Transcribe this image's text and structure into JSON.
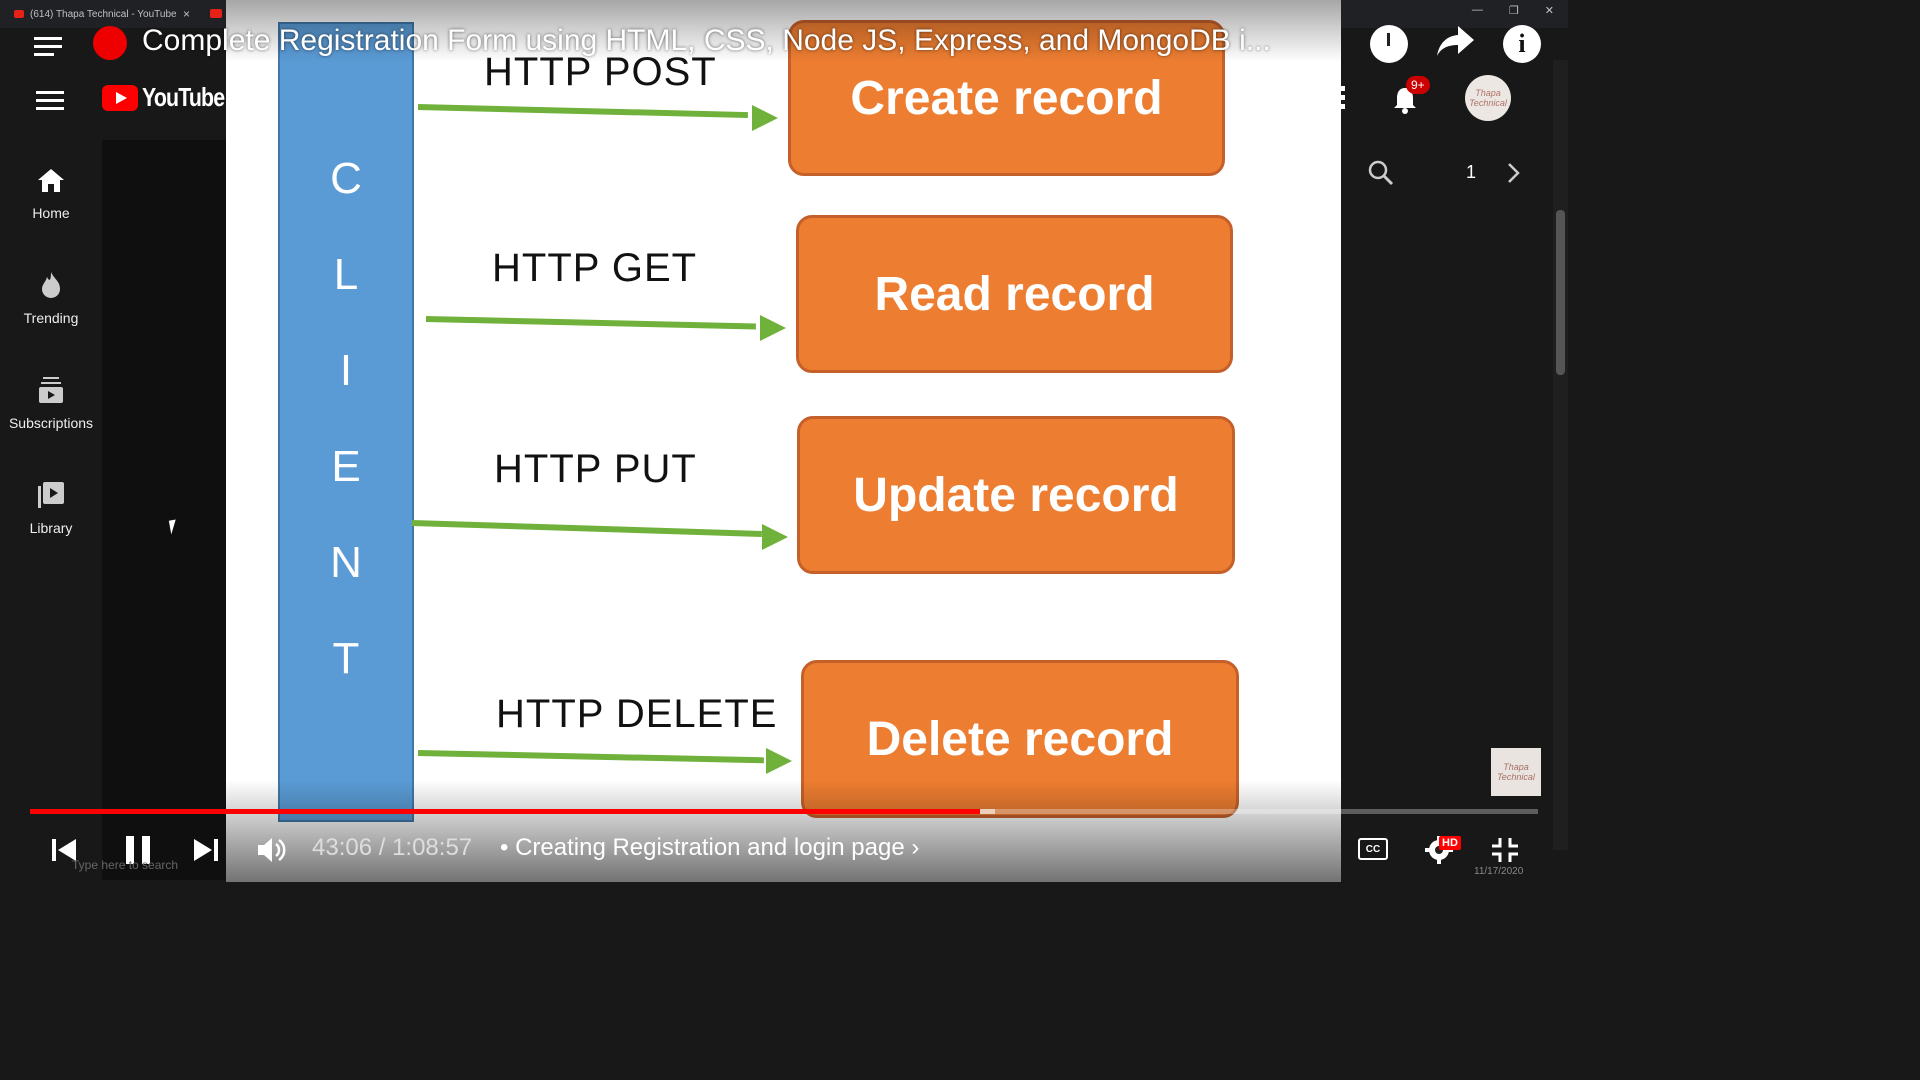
{
  "browser": {
    "tab_title": "(614) Thapa Technical - YouTube",
    "tab_close": "×",
    "win_minimize": "—",
    "win_restore": "❐",
    "win_close": "✕"
  },
  "youtube": {
    "logo_text": "YouTube",
    "sidebar": [
      {
        "label": "Home",
        "icon": "home-icon"
      },
      {
        "label": "Trending",
        "icon": "flame-icon"
      },
      {
        "label": "Subscriptions",
        "icon": "subscriptions-icon"
      },
      {
        "label": "Library",
        "icon": "library-icon"
      }
    ],
    "notifications_badge": "9+",
    "avatar_text": "Thapa Technical",
    "page_number": "1"
  },
  "player": {
    "title": "Complete Registration Form using HTML, CSS, Node JS, Express, and MongoDB i...",
    "time_current": "43:06",
    "time_total": "1:08:57",
    "time_display": "43:06 / 1:08:57",
    "chapter": "• Creating Registration and login page",
    "chapter_chevron": "›",
    "progress_fraction": 0.63,
    "buffer_fraction": 0.64,
    "hd_badge": "HD",
    "cc_label": "CC",
    "watermark_text": "Thapa Technical",
    "accent_color": "#ff0000"
  },
  "slide": {
    "client_letters": [
      "C",
      "L",
      "I",
      "E",
      "N",
      "T"
    ],
    "rows": [
      {
        "method": "HTTP POST",
        "action": "Create record"
      },
      {
        "method": "HTTP GET",
        "action": "Read record"
      },
      {
        "method": "HTTP PUT",
        "action": "Update record"
      },
      {
        "method": "HTTP DELETE",
        "action": "Delete record"
      }
    ],
    "client_color": "#5a9bd5",
    "box_color": "#ed7d31",
    "arrow_color": "#6fb13a"
  },
  "taskbar": {
    "search_hint": "Type here to search",
    "date": "11/17/2020"
  }
}
